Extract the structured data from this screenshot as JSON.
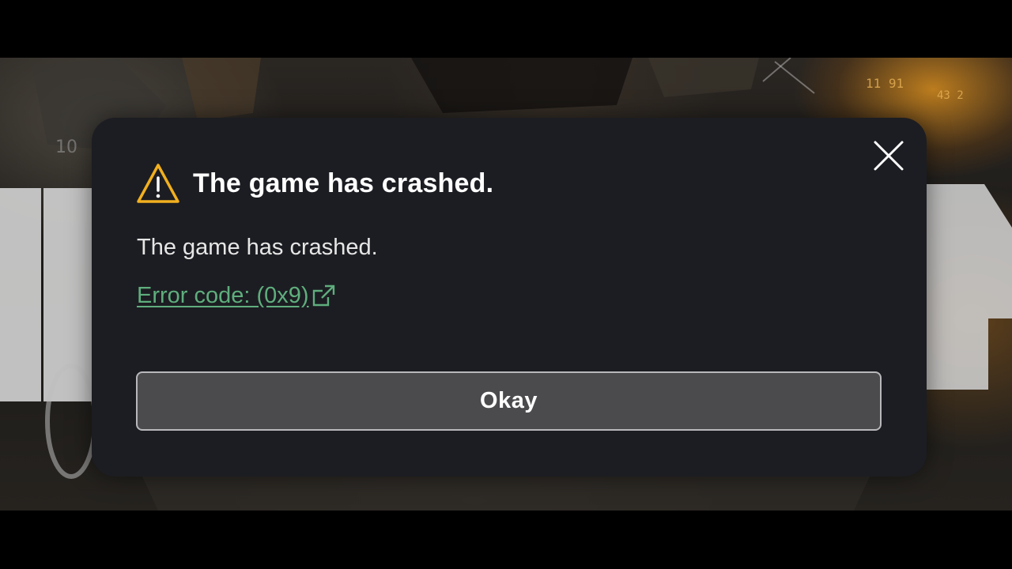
{
  "dialog": {
    "title": "The game has crashed.",
    "message": "The game has crashed.",
    "error_link": "Error code: (0x9)",
    "button_label": "Okay",
    "icons": {
      "warning": "warning-triangle-icon",
      "close": "close-icon",
      "external_link": "external-link-icon"
    }
  },
  "colors": {
    "dialog_background": "#1c1d22",
    "warning": "#f2b01e",
    "link": "#5fae7d",
    "button_background": "#4b4b4e",
    "button_border": "#b8b8bb"
  }
}
